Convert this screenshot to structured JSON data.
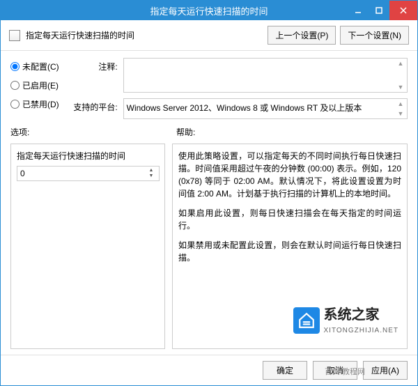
{
  "window": {
    "title": "指定每天运行快速扫描的时间"
  },
  "header": {
    "title": "指定每天运行快速扫描的时间",
    "prev_btn": "上一个设置(P)",
    "next_btn": "下一个设置(N)"
  },
  "radios": {
    "not_configured": "未配置(C)",
    "enabled": "已启用(E)",
    "disabled": "已禁用(D)",
    "selected": "not_configured"
  },
  "fields": {
    "comment_label": "注释:",
    "comment_value": "",
    "platform_label": "支持的平台:",
    "platform_value": "Windows Server 2012、Windows 8 或 Windows RT 及以上版本"
  },
  "labels": {
    "options": "选项:",
    "help": "帮助:"
  },
  "options_panel": {
    "field_label": "指定每天运行快速扫描的时间",
    "value": "0"
  },
  "help_text": {
    "p1": "使用此策略设置，可以指定每天的不同时间执行每日快速扫描。时间值采用超过午夜的分钟数 (00:00) 表示。例如，120 (0x78) 等同于 02:00 AM。默认情况下，将此设置设置为时间值 2:00 AM。计划基于执行扫描的计算机上的本地时间。",
    "p2": "如果启用此设置，则每日快速扫描会在每天指定的时间运行。",
    "p3": "如果禁用或未配置此设置，则会在默认时间运行每日快速扫描。"
  },
  "watermark": {
    "title": "系统之家",
    "sub": "XITONGZHIJIA.NET"
  },
  "footer": {
    "ok": "确定",
    "cancel": "取消",
    "apply": "应用(A)",
    "overlay": "百典  教程网"
  }
}
